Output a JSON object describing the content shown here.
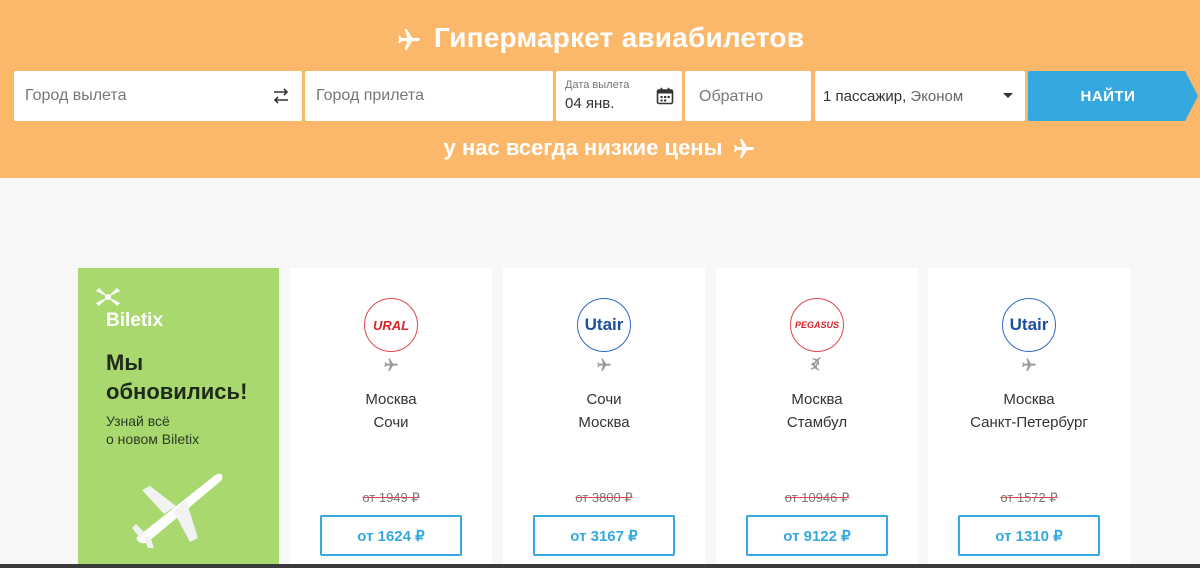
{
  "header": {
    "title": "Гипермаркет авиабилетов",
    "subtitle": "у нас всегда низкие цены"
  },
  "search": {
    "from_placeholder": "Город вылета",
    "to_placeholder": "Город прилета",
    "date_label": "Дата вылета",
    "date_value": "04 янв.",
    "return_placeholder": "Обратно",
    "passengers": "1 пассажир,",
    "class": "Эконом",
    "button": "НАЙТИ"
  },
  "promo": {
    "brand": "Biletix",
    "headline_line1": "Мы",
    "headline_line2": "обновились!",
    "text_line1": "Узнай всё",
    "text_line2": "о новом Biletix"
  },
  "offers": [
    {
      "airline": "URAL",
      "from": "Москва",
      "to": "Сочи",
      "old_price": "от 1949 ₽",
      "price": "от 1624 ₽"
    },
    {
      "airline": "Utair",
      "from": "Сочи",
      "to": "Москва",
      "old_price": "от 3800 ₽",
      "price": "от 3167 ₽"
    },
    {
      "airline": "PEGASUS",
      "from": "Москва",
      "to": "Стамбул",
      "old_price": "от 10946 ₽",
      "price": "от 9122 ₽"
    },
    {
      "airline": "Utair",
      "from": "Москва",
      "to": "Санкт-Петербург",
      "old_price": "от 1572 ₽",
      "price": "от 1310 ₽"
    }
  ],
  "colors": {
    "header_bg": "#fbb86b",
    "accent_blue": "#35a8e0",
    "promo_bg": "#a9d86e",
    "strike_red": "#e0464f"
  },
  "icons": [
    "plane-icon",
    "swap-icon",
    "calendar-icon",
    "dropdown-caret-icon",
    "transfer-plane-icon"
  ]
}
